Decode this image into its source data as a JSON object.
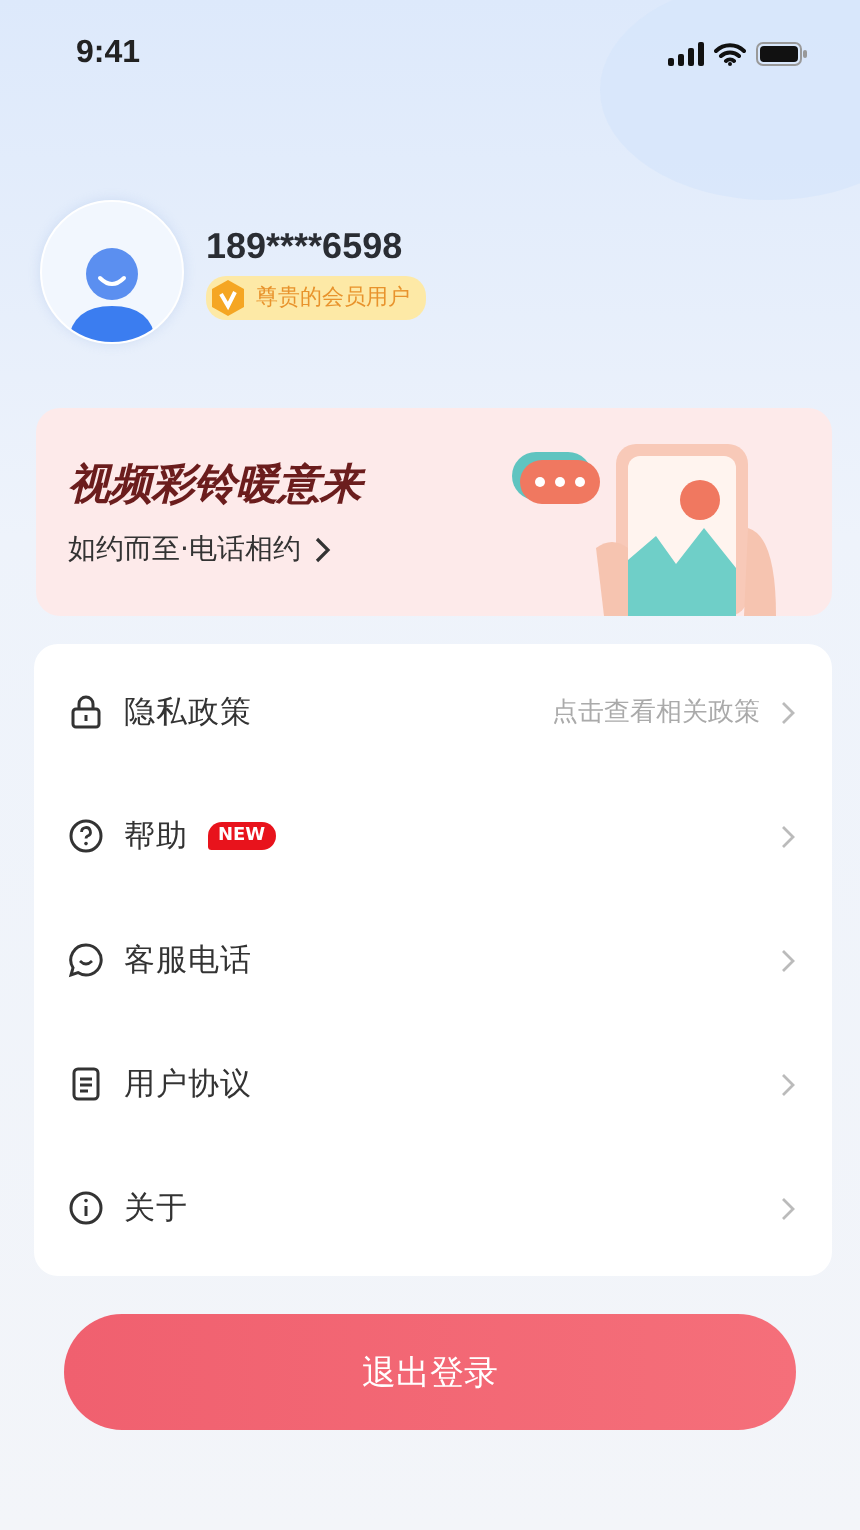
{
  "status_bar": {
    "time": "9:41"
  },
  "profile": {
    "phone": "189****6598",
    "member_badge": "尊贵的会员用户"
  },
  "banner": {
    "title": "视频彩铃暖意来",
    "subtitle": "如约而至·电话相约"
  },
  "menu": [
    {
      "label": "隐私政策",
      "hint": "点击查看相关政策"
    },
    {
      "label": "帮助",
      "badge": "NEW"
    },
    {
      "label": "客服电话"
    },
    {
      "label": "用户协议"
    },
    {
      "label": "关于"
    }
  ],
  "logout_button": "退出登录"
}
